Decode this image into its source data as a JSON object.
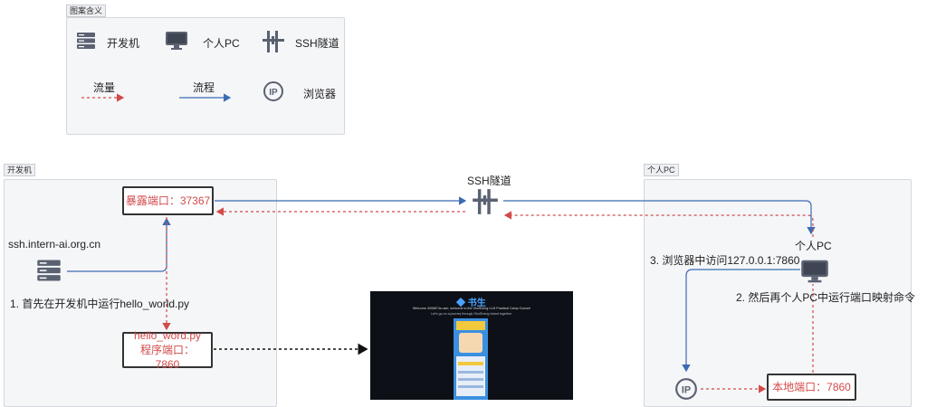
{
  "legend": {
    "title": "图案含义",
    "items": [
      {
        "icon": "server-icon",
        "label": "开发机"
      },
      {
        "icon": "monitor-icon",
        "label": "个人PC"
      },
      {
        "icon": "ssh-tunnel-icon",
        "label": "SSH隧道"
      },
      {
        "icon": "dashed-red-arrow",
        "label": "流量"
      },
      {
        "icon": "solid-blue-arrow",
        "label": "流程"
      },
      {
        "icon": "ip-browser-icon",
        "label": "浏览器"
      }
    ]
  },
  "dev_panel": {
    "tag": "开发机",
    "host": "ssh.intern-ai.org.cn",
    "exposed_port": "暴露端口：37367",
    "step1": "1. 首先在开发机中运行hello_world.py",
    "app_port": "hello_word.py程序端口：7860"
  },
  "tunnel": {
    "label": "SSH隧道"
  },
  "pc_panel": {
    "tag": "个人PC",
    "pc_label": "个人PC",
    "step3": "3. 浏览器中访问127.0.0.1:7860",
    "step2": "2. 然后再个人PC中运行端口映射命令",
    "local_port": "本地端口：7860"
  },
  "browser_preview": {
    "brand": "书生",
    "line1": "Welcome 4008874s user, welcome to the ShuSheng LLM Practical Camp Course!",
    "line2": "Let's go on a journey through ShuSheng Island together."
  },
  "colors": {
    "flow": "#3b6bb5",
    "traffic": "#d24a4a",
    "panel": "#f5f6f8"
  }
}
